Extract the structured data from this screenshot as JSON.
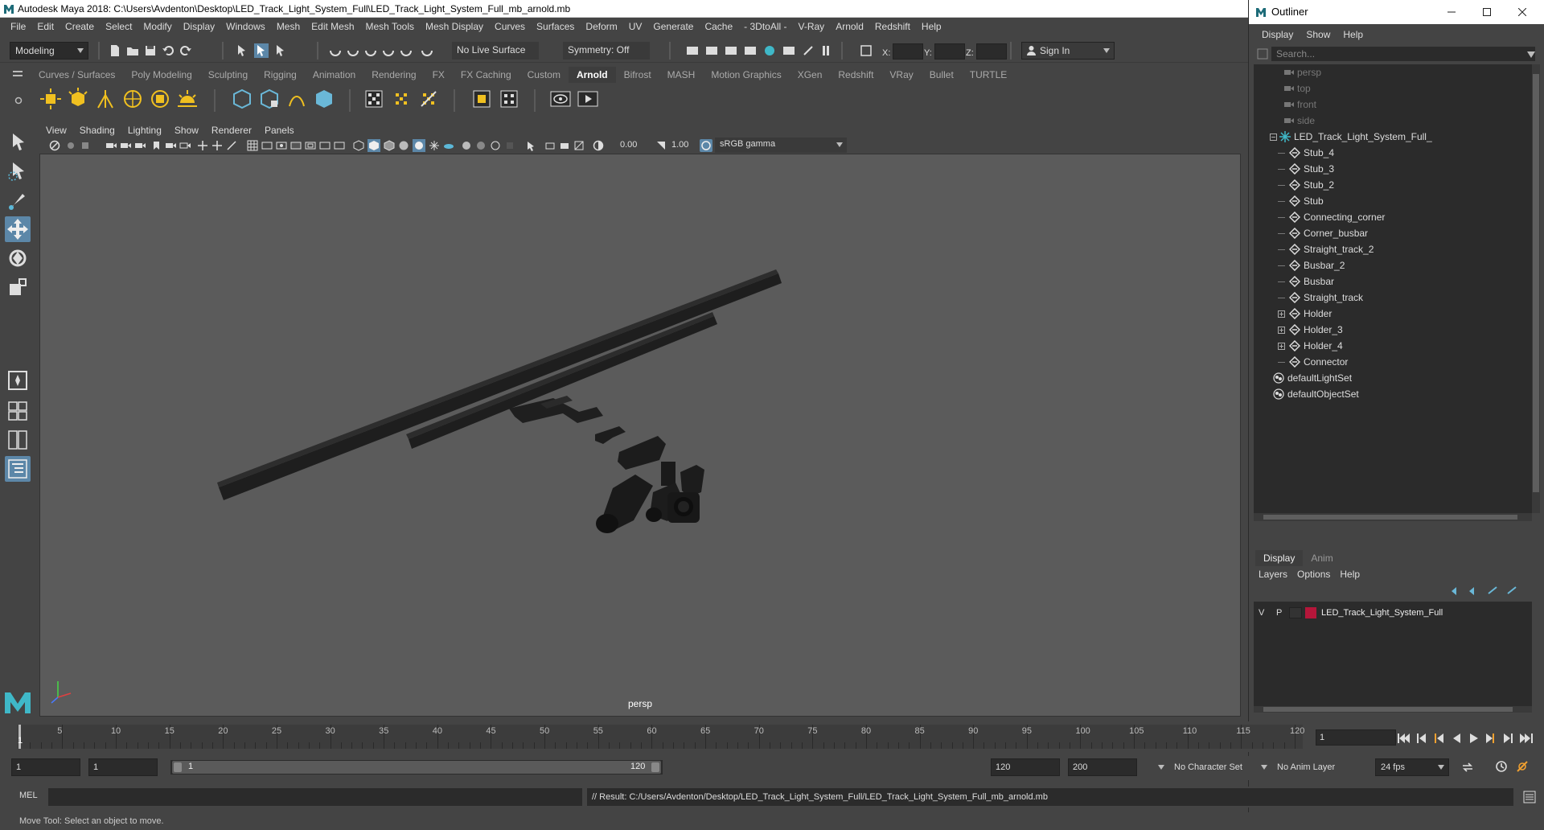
{
  "window": {
    "title": "Autodesk Maya 2018: C:\\Users\\Avdenton\\Desktop\\LED_Track_Light_System_Full\\LED_Track_Light_System_Full_mb_arnold.mb"
  },
  "menubar": [
    "File",
    "Edit",
    "Create",
    "Select",
    "Modify",
    "Display",
    "Windows",
    "Mesh",
    "Edit Mesh",
    "Mesh Tools",
    "Mesh Display",
    "Curves",
    "Surfaces",
    "Deform",
    "UV",
    "Generate",
    "Cache",
    "- 3DtoAll -",
    "V-Ray",
    "Arnold",
    "Redshift",
    "Help"
  ],
  "statusline": {
    "mode": "Modeling",
    "live_surface": "No Live Surface",
    "symmetry": "Symmetry: Off",
    "x_label": "X:",
    "y_label": "Y:",
    "z_label": "Z:",
    "sign_in": "Sign In"
  },
  "shelf_tabs": [
    "Curves / Surfaces",
    "Poly Modeling",
    "Sculpting",
    "Rigging",
    "Animation",
    "Rendering",
    "FX",
    "FX Caching",
    "Custom",
    "Arnold",
    "Bifrost",
    "MASH",
    "Motion Graphics",
    "XGen",
    "Redshift",
    "VRay",
    "Bullet",
    "TURTLE"
  ],
  "shelf_active": "Arnold",
  "viewport": {
    "menu": [
      "View",
      "Shading",
      "Lighting",
      "Show",
      "Renderer",
      "Panels"
    ],
    "exposure": "0.00",
    "gamma": "1.00",
    "color_space": "sRGB gamma",
    "camera_label": "persp"
  },
  "outliner": {
    "title": "Outliner",
    "menu": [
      "Display",
      "Show",
      "Help"
    ],
    "search_placeholder": "Search...",
    "cameras": [
      "persp",
      "top",
      "front",
      "side"
    ],
    "group": "LED_Track_Light_System_Full_",
    "children": [
      "Stub_4",
      "Stub_3",
      "Stub_2",
      "Stub",
      "Connecting_corner",
      "Corner_busbar",
      "Straight_track_2",
      "Busbar_2",
      "Busbar",
      "Straight_track",
      "Holder",
      "Holder_3",
      "Holder_4",
      "Connector"
    ],
    "expandable": [
      "Holder",
      "Holder_3",
      "Holder_4"
    ],
    "sets": [
      "defaultLightSet",
      "defaultObjectSet"
    ]
  },
  "layers": {
    "tabs": [
      "Display",
      "Anim"
    ],
    "menu": [
      "Layers",
      "Options",
      "Help"
    ],
    "layer_v": "V",
    "layer_p": "P",
    "layer_name": "LED_Track_Light_System_Full",
    "layer_color": "#b5163a"
  },
  "timeslider": {
    "labels": [
      "1",
      "5",
      "10",
      "15",
      "20",
      "25",
      "30",
      "35",
      "40",
      "45",
      "50",
      "55",
      "60",
      "65",
      "70",
      "75",
      "80",
      "85",
      "90",
      "95",
      "100",
      "105",
      "110",
      "115",
      "120"
    ],
    "current_frame": "1"
  },
  "rangeslider": {
    "start": "1",
    "playback_start": "1",
    "range_start": "1",
    "range_end": "120",
    "playback_end": "120",
    "end": "200",
    "character_set": "No Character Set",
    "anim_layer": "No Anim Layer",
    "fps": "24 fps"
  },
  "cmdline": {
    "label": "MEL",
    "result": "// Result: C:/Users/Avdenton/Desktop/LED_Track_Light_System_Full/LED_Track_Light_System_Full_mb_arnold.mb"
  },
  "helpline": "Move Tool: Select an object to move.",
  "colors": {
    "accent": "#5c87a8",
    "maya_teal": "#3fb8c8"
  }
}
